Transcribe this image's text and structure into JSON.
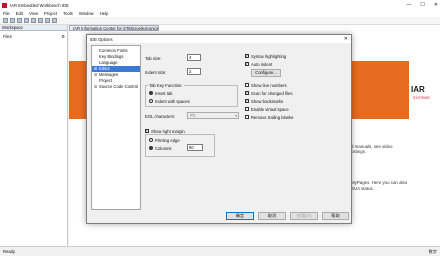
{
  "app": {
    "title": "IAR Embedded Workbench IDE",
    "window_controls": {
      "minimize": "—",
      "maximize": "☐",
      "close": "✕"
    }
  },
  "menu": [
    "File",
    "Edit",
    "View",
    "Project",
    "Tools",
    "Window",
    "Help"
  ],
  "workspace": {
    "header": "Workspace",
    "files_label": "Files",
    "files_icon": "gear-icon"
  },
  "document": {
    "tab_title": "IAR Information Center for STMicroelectronics STM8",
    "logo": "IAR",
    "logo_sub": "SYSTEMS",
    "text_1": "d manuals, see video",
    "text_1b": "ostings.",
    "text_2": "MyPages. Here you can also",
    "text_2b": "SUA status."
  },
  "status": {
    "left": "Ready",
    "right_1": "数字"
  },
  "dialog": {
    "title": "IDE Options",
    "close_glyph": "✕",
    "tree": [
      {
        "label": "Common Fonts",
        "expander": ""
      },
      {
        "label": "Key Bindings",
        "expander": ""
      },
      {
        "label": "Language",
        "expander": ""
      },
      {
        "label": "Editor",
        "expander": "⊞",
        "selected": true
      },
      {
        "label": "Messages",
        "expander": "⊞"
      },
      {
        "label": "Project",
        "expander": ""
      },
      {
        "label": "Source Code Control",
        "expander": "⊞"
      }
    ],
    "tab_size_label": "Tab size:",
    "tab_size_value": "4",
    "indent_size_label": "Indent size:",
    "indent_size_value": "2",
    "tab_key_group": "Tab Key Function:",
    "insert_tab_label": "Insert tab",
    "indent_spaces_label": "Indent with spaces",
    "eol_label": "EOL characters:",
    "eol_value": "PC",
    "show_right_margin_label": "Show right margin",
    "printing_edge_label": "Printing edge",
    "columns_label": "Columns",
    "columns_value": "80",
    "syntax_highlighting_label": "Syntax highlighting",
    "auto_indent_label": "Auto indent",
    "configure_label": "Configure...",
    "show_line_numbers_label": "Show line numbers",
    "scan_changed_files_label": "Scan for changed files",
    "show_bookmarks_label": "Show bookmarks",
    "enable_virtual_space_label": "Enable virtual space",
    "remove_trailing_blanks_label": "Remove trailing blanks",
    "ok_label": "确定",
    "cancel_label": "取消",
    "apply_label": "应用(A)",
    "help_label": "帮助"
  },
  "colors": {
    "banner": "#e86a1e",
    "selection": "#3a79d4",
    "brand_red": "#c8102e"
  }
}
